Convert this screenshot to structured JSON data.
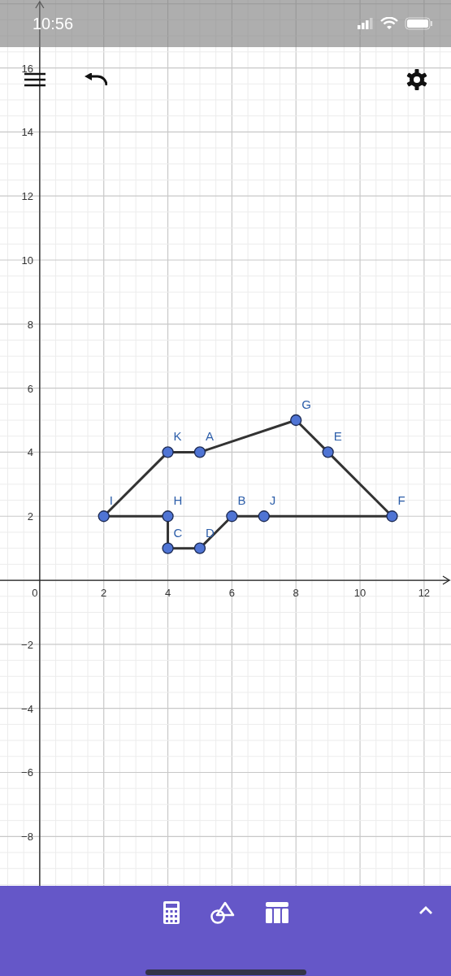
{
  "status_bar": {
    "time": "10:56"
  },
  "graph": {
    "chart_data": {
      "type": "scatter",
      "grid": true,
      "x": [
        2,
        4,
        5,
        8,
        9,
        11,
        7,
        6,
        5,
        4,
        4
      ],
      "series": [
        {
          "color": "#4f74d4",
          "values": [
            2,
            4,
            4,
            5,
            4,
            2,
            2,
            2,
            1,
            1,
            2
          ]
        }
      ],
      "xlim": [
        -1.24,
        12.84
      ],
      "ylim": [
        -9.54,
        18.12
      ],
      "xticks": [
        {
          "value": 0,
          "label": "0"
        },
        2,
        4,
        6,
        8,
        10,
        12
      ],
      "yticks": [
        {
          "value": -8,
          "label": "−8"
        },
        {
          "value": -6,
          "label": "−6"
        },
        {
          "value": -4,
          "label": "−4"
        },
        {
          "value": -2,
          "label": "−2"
        },
        2,
        4,
        6,
        8,
        10,
        12,
        14,
        16
      ],
      "annotations": [
        {
          "text": "I",
          "x": 2,
          "y": 2
        },
        {
          "text": "K",
          "x": 4,
          "y": 4
        },
        {
          "text": "A",
          "x": 5,
          "y": 4
        },
        {
          "text": "G",
          "x": 8,
          "y": 5
        },
        {
          "text": "E",
          "x": 9,
          "y": 4
        },
        {
          "text": "F",
          "x": 11,
          "y": 2
        },
        {
          "text": "J",
          "x": 7,
          "y": 2
        },
        {
          "text": "B",
          "x": 6,
          "y": 2
        },
        {
          "text": "D",
          "x": 5,
          "y": 1
        },
        {
          "text": "C",
          "x": 4,
          "y": 1
        },
        {
          "text": "H",
          "x": 4,
          "y": 2
        }
      ]
    }
  }
}
